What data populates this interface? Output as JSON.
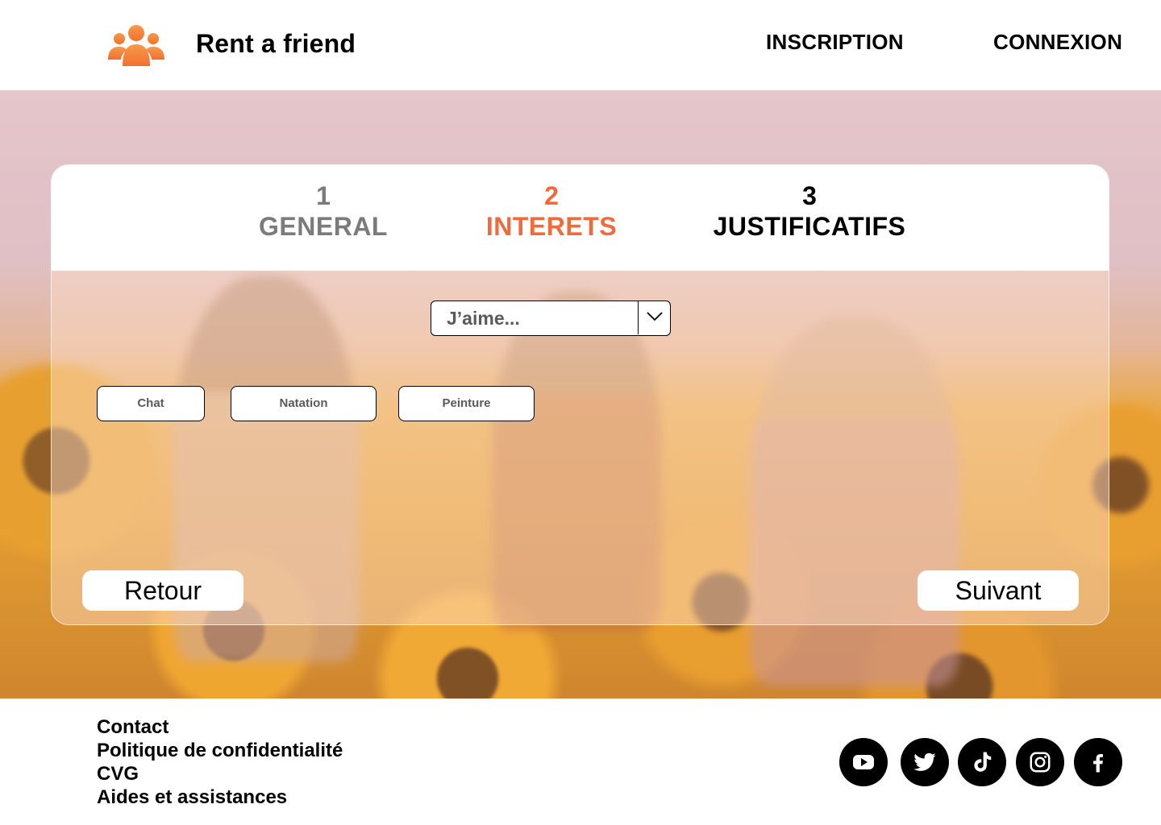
{
  "header": {
    "brand": "Rent a friend",
    "logo_icon": "group-icon",
    "nav": {
      "inscription": "INSCRIPTION",
      "connexion": "CONNEXION"
    }
  },
  "steps": [
    {
      "number": "1",
      "label": "GENERAL",
      "state": "done"
    },
    {
      "number": "2",
      "label": "INTERETS",
      "state": "active"
    },
    {
      "number": "3",
      "label": "JUSTIFICATIFS",
      "state": "upcoming"
    }
  ],
  "form": {
    "interest_select": {
      "value": "J’aime...",
      "icon": "chevron-down-icon"
    },
    "tags": [
      "Chat",
      "Natation",
      "Peinture"
    ],
    "back_label": "Retour",
    "next_label": "Suivant"
  },
  "footer": {
    "links": [
      "Contact",
      "Politique de confidentialité",
      "CVG",
      "Aides et assistances"
    ],
    "social": [
      "youtube-icon",
      "twitter-icon",
      "tiktok-icon",
      "instagram-icon",
      "facebook-icon"
    ]
  },
  "colors": {
    "accent": "#ef6a3c",
    "logo": "#f4803a",
    "step_done": "#7b7b7b",
    "step_upcoming": "#000000"
  }
}
